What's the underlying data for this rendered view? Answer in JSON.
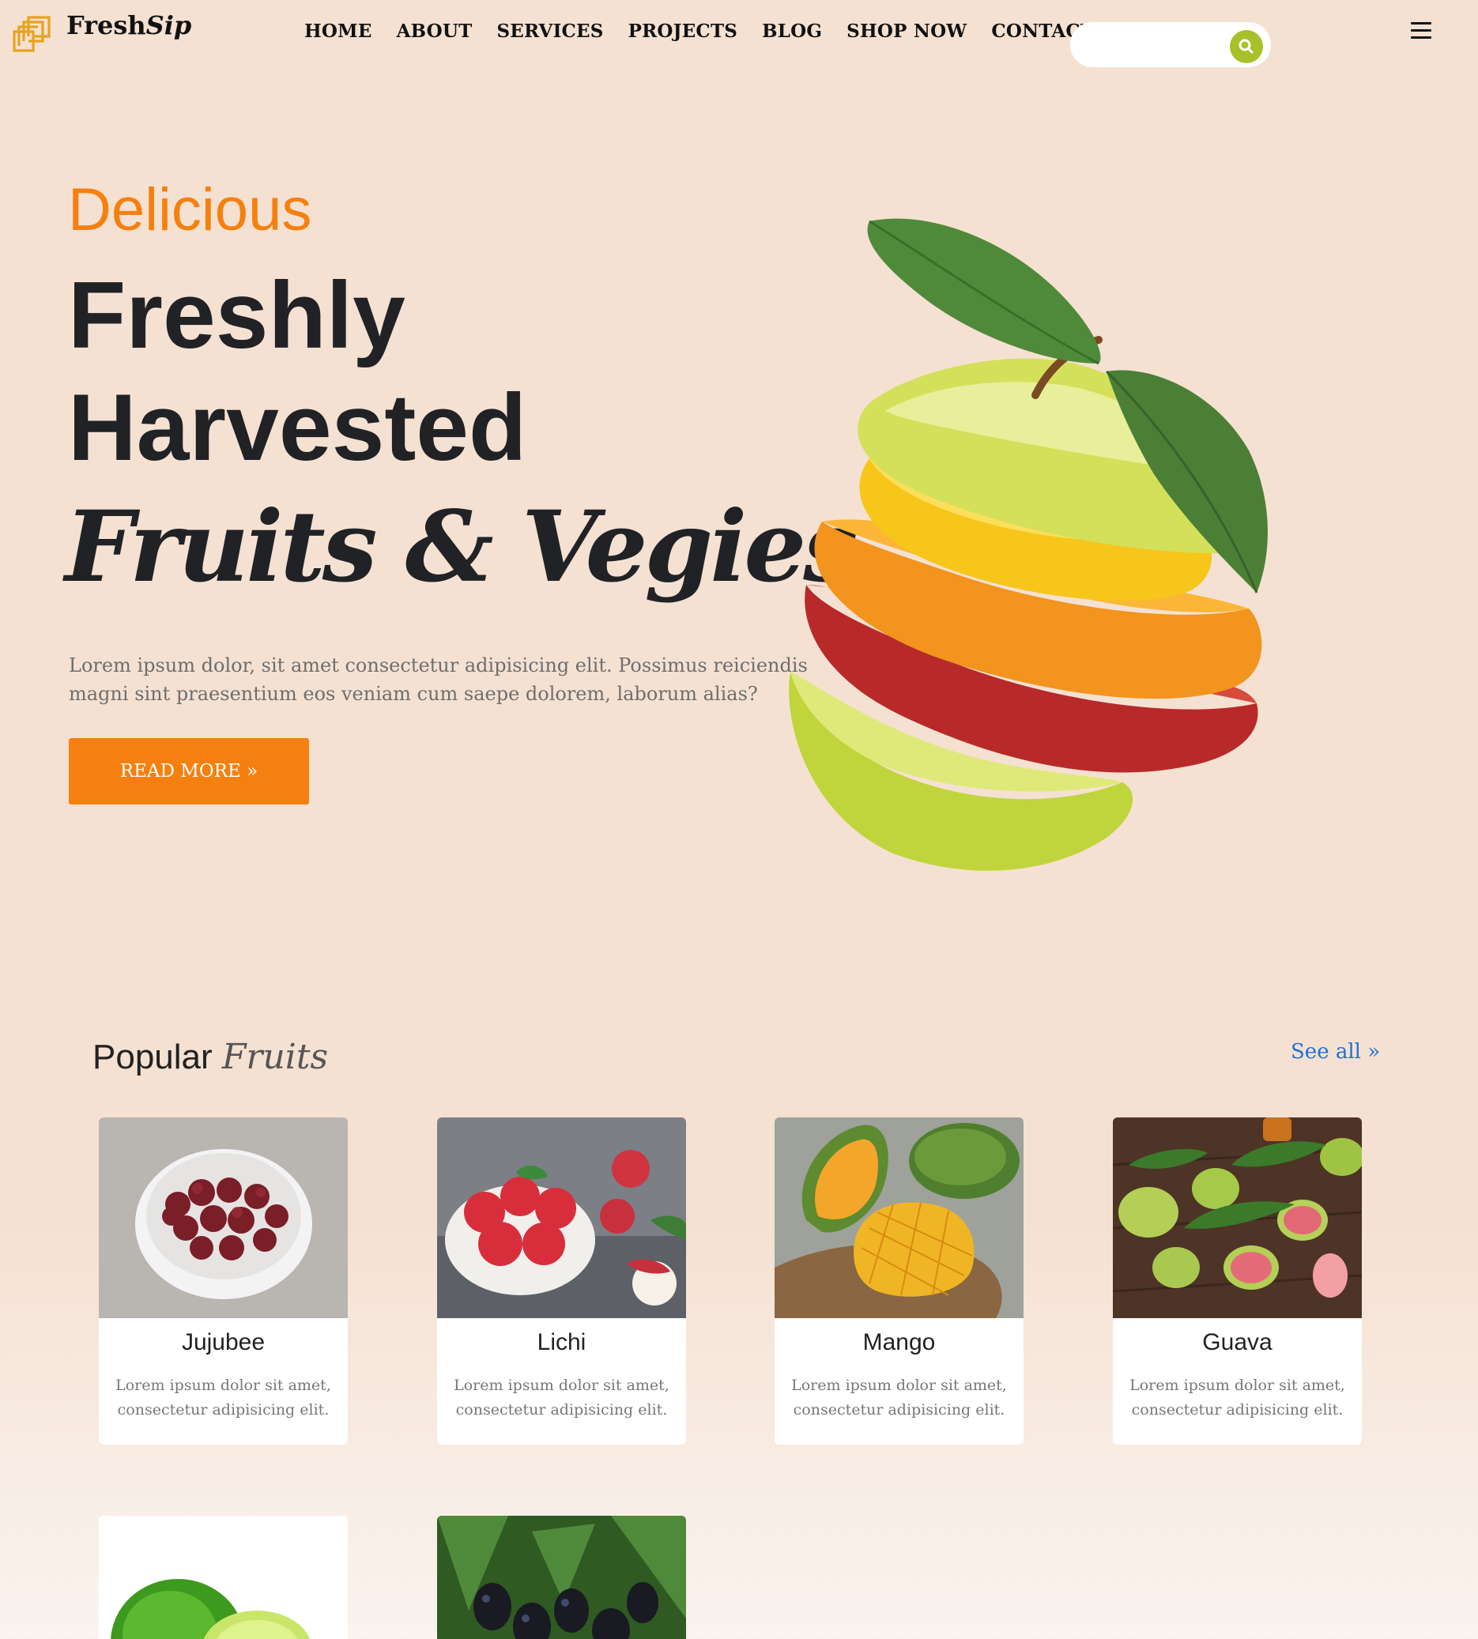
{
  "brand": {
    "name_a": "Fresh",
    "name_b": "Sip"
  },
  "nav": {
    "items": [
      "HOME",
      "ABOUT",
      "SERVICES",
      "PROJECTS",
      "BLOG",
      "SHOP NOW",
      "CONTACTS"
    ]
  },
  "search": {
    "placeholder": "",
    "icon": "search-icon"
  },
  "colors": {
    "accent": "#f5800f",
    "search_button": "#a9c02a",
    "link": "#1f6fd8",
    "background": "#f5e1d2"
  },
  "hero": {
    "eyebrow": "Delicious",
    "line1": "Freshly",
    "line2": "Harvested",
    "line3": "Fruits & Vegies",
    "description": "Lorem ipsum dolor, sit amet consectetur adipisicing elit. Possimus reiciendis magni sint praesentium eos veniam cum saepe dolorem, laborum alias?",
    "button_label": "READ MORE »"
  },
  "popular": {
    "title_a": "Popular",
    "title_b": "Fruits",
    "see_all": "See all »",
    "cards": [
      {
        "name": "Jujubee",
        "desc": "Lorem ipsum dolor sit amet, consectetur adipisicing elit."
      },
      {
        "name": "Lichi",
        "desc": "Lorem ipsum dolor sit amet, consectetur adipisicing elit."
      },
      {
        "name": "Mango",
        "desc": "Lorem ipsum dolor sit amet, consectetur adipisicing elit."
      },
      {
        "name": "Guava",
        "desc": "Lorem ipsum dolor sit amet, consectetur adipisicing elit."
      }
    ]
  }
}
